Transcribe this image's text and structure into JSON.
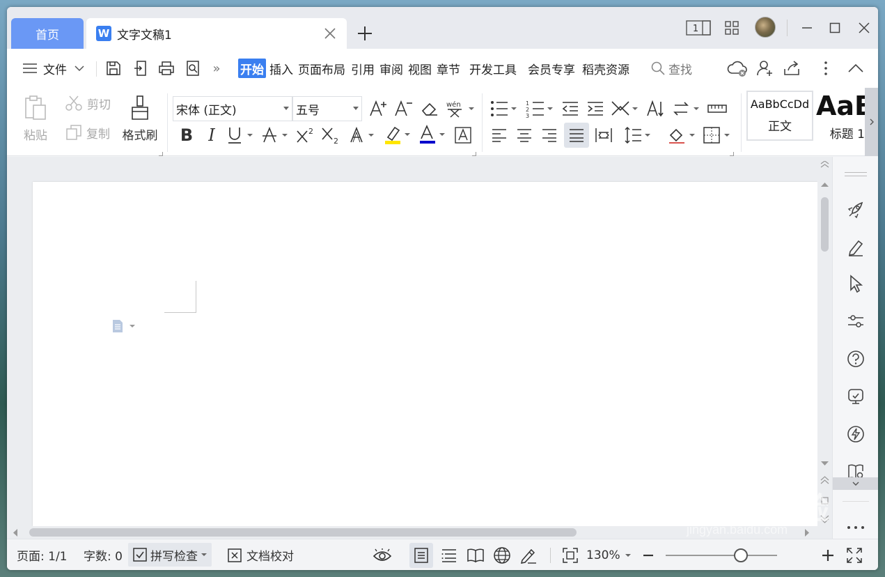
{
  "tabs": {
    "home_label": "首页",
    "doc_title": "文字文稿1",
    "doc_logo": "W"
  },
  "menu": {
    "file_label": "文件",
    "items": [
      "开始",
      "插入",
      "页面布局",
      "引用",
      "审阅",
      "视图",
      "章节",
      "开发工具",
      "会员专享",
      "稻壳资源"
    ],
    "search_label": "查找"
  },
  "ribbon": {
    "paste_label": "粘贴",
    "cut_label": "剪切",
    "copy_label": "复制",
    "format_painter_label": "格式刷",
    "font_name": "宋体 (正文)",
    "font_size": "五号",
    "styles": [
      {
        "sample": "AaBbCcDd",
        "name": "正文"
      },
      {
        "sample": "AaB",
        "name": "标题 1"
      }
    ]
  },
  "window_indicator": "1",
  "status": {
    "page": "页面: 1/1",
    "word_count": "字数: 0",
    "spell_check": "拼写检查",
    "proofread": "文档校对",
    "zoom": "130%",
    "zoom_fraction": 0.6
  },
  "watermark": {
    "brand": "Baidu经验",
    "url": "jingyan.baidu.com"
  },
  "colors": {
    "accent": "#3a7ff0",
    "home_tab": "#6a98f5",
    "highlight": "#ffe600",
    "font_color": "#0000cc"
  }
}
